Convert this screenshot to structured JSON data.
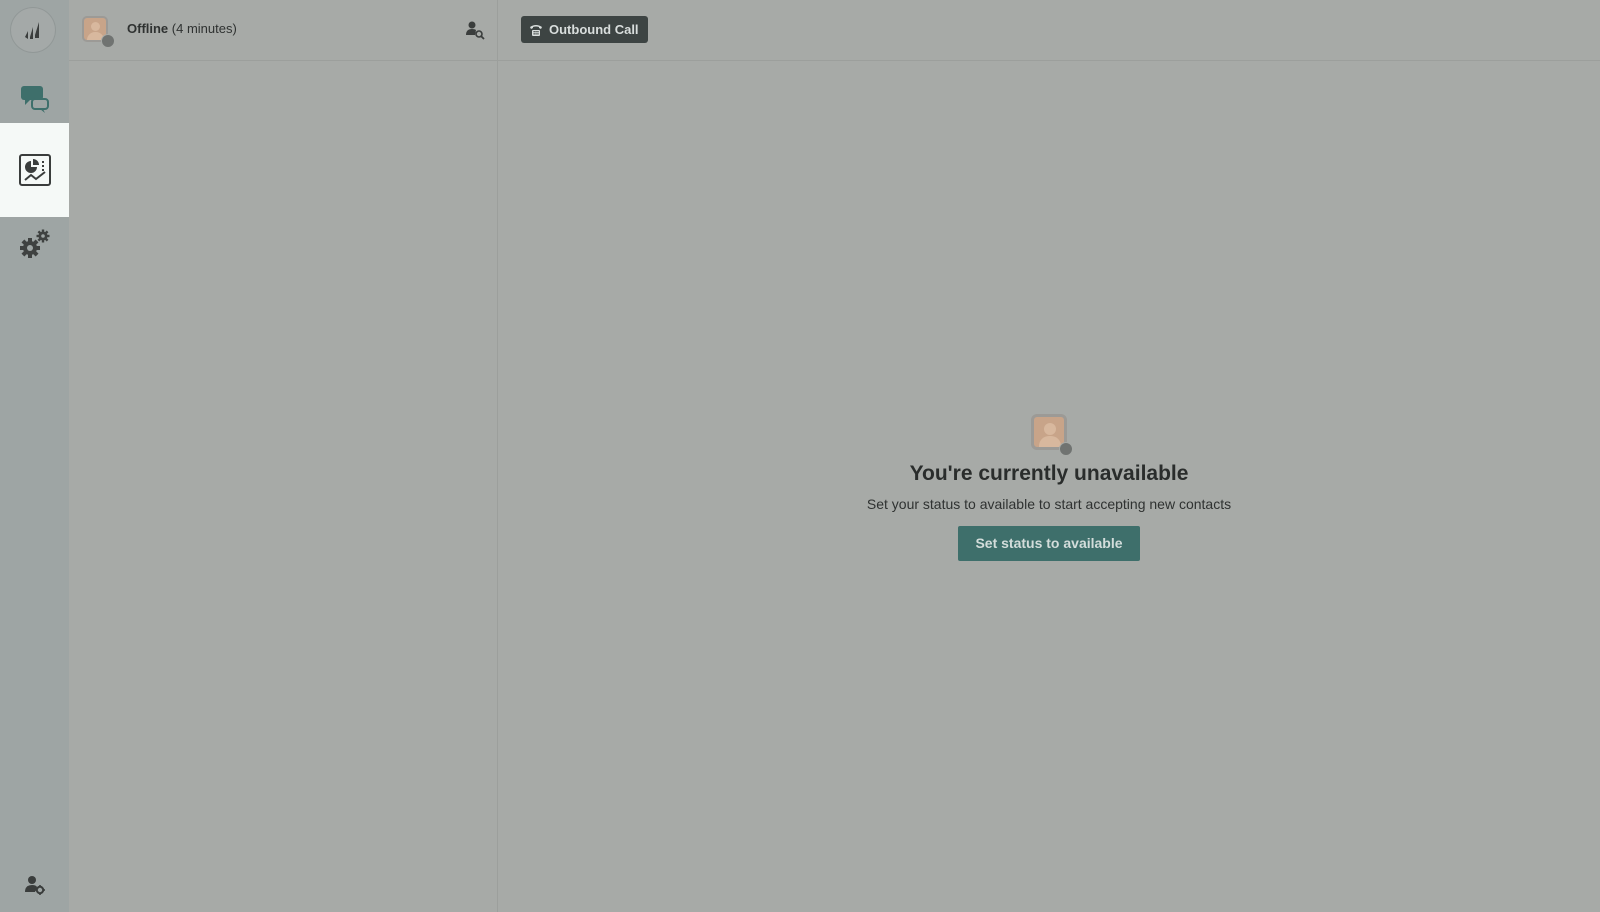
{
  "status": {
    "state": "Offline",
    "duration": "(4 minutes)"
  },
  "toolbar": {
    "outbound_call_label": "Outbound Call"
  },
  "empty_state": {
    "title": "You're currently unavailable",
    "subtitle": "Set your status to available to start accepting new contacts",
    "button_label": "Set status to available"
  },
  "icons": {
    "logo": "brand-logo-icon",
    "chat": "chat-bubbles-icon",
    "dashboard": "analytics-dashboard-icon",
    "settings": "gears-icon",
    "profile_settings": "user-gear-icon",
    "contact_search": "user-search-icon",
    "phone": "phone-icon"
  },
  "colors": {
    "rail_background": "#9ea5a4",
    "active_nav": "#f5f9f7",
    "chat_icon": "#3e6f6b",
    "primary_button": "#3e6f6b",
    "outbound_button": "#3d4443",
    "offline_dot": "#707371"
  }
}
